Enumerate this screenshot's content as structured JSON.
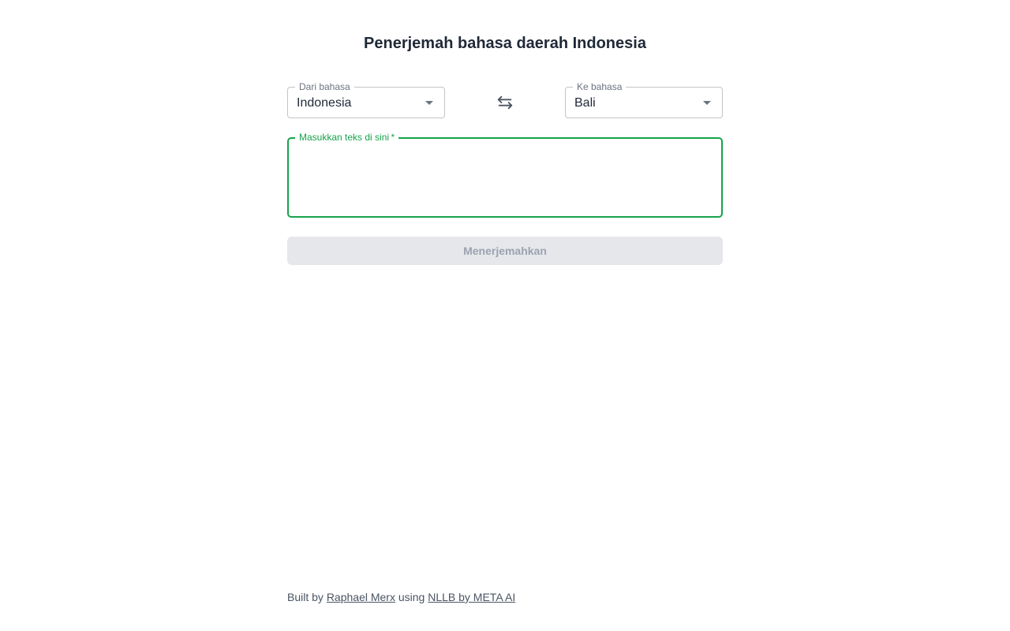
{
  "header": {
    "title": "Penerjemah bahasa daerah Indonesia"
  },
  "source_language": {
    "label": "Dari bahasa",
    "value": "Indonesia"
  },
  "target_language": {
    "label": "Ke bahasa",
    "value": "Bali"
  },
  "swap": {
    "icon": "swap-arrows-icon"
  },
  "input": {
    "label": "Masukkan teks di sini",
    "required_marker": "*",
    "value": ""
  },
  "translate_button": {
    "label": "Menerjemahkan"
  },
  "footer": {
    "built_by": "Built by",
    "author_link": "Raphael Merx",
    "using": "using",
    "model_link": "NLLB by META AI"
  },
  "colors": {
    "accent": "#16a34a",
    "button_bg": "#e5e7eb",
    "button_text": "#9ca3af"
  }
}
